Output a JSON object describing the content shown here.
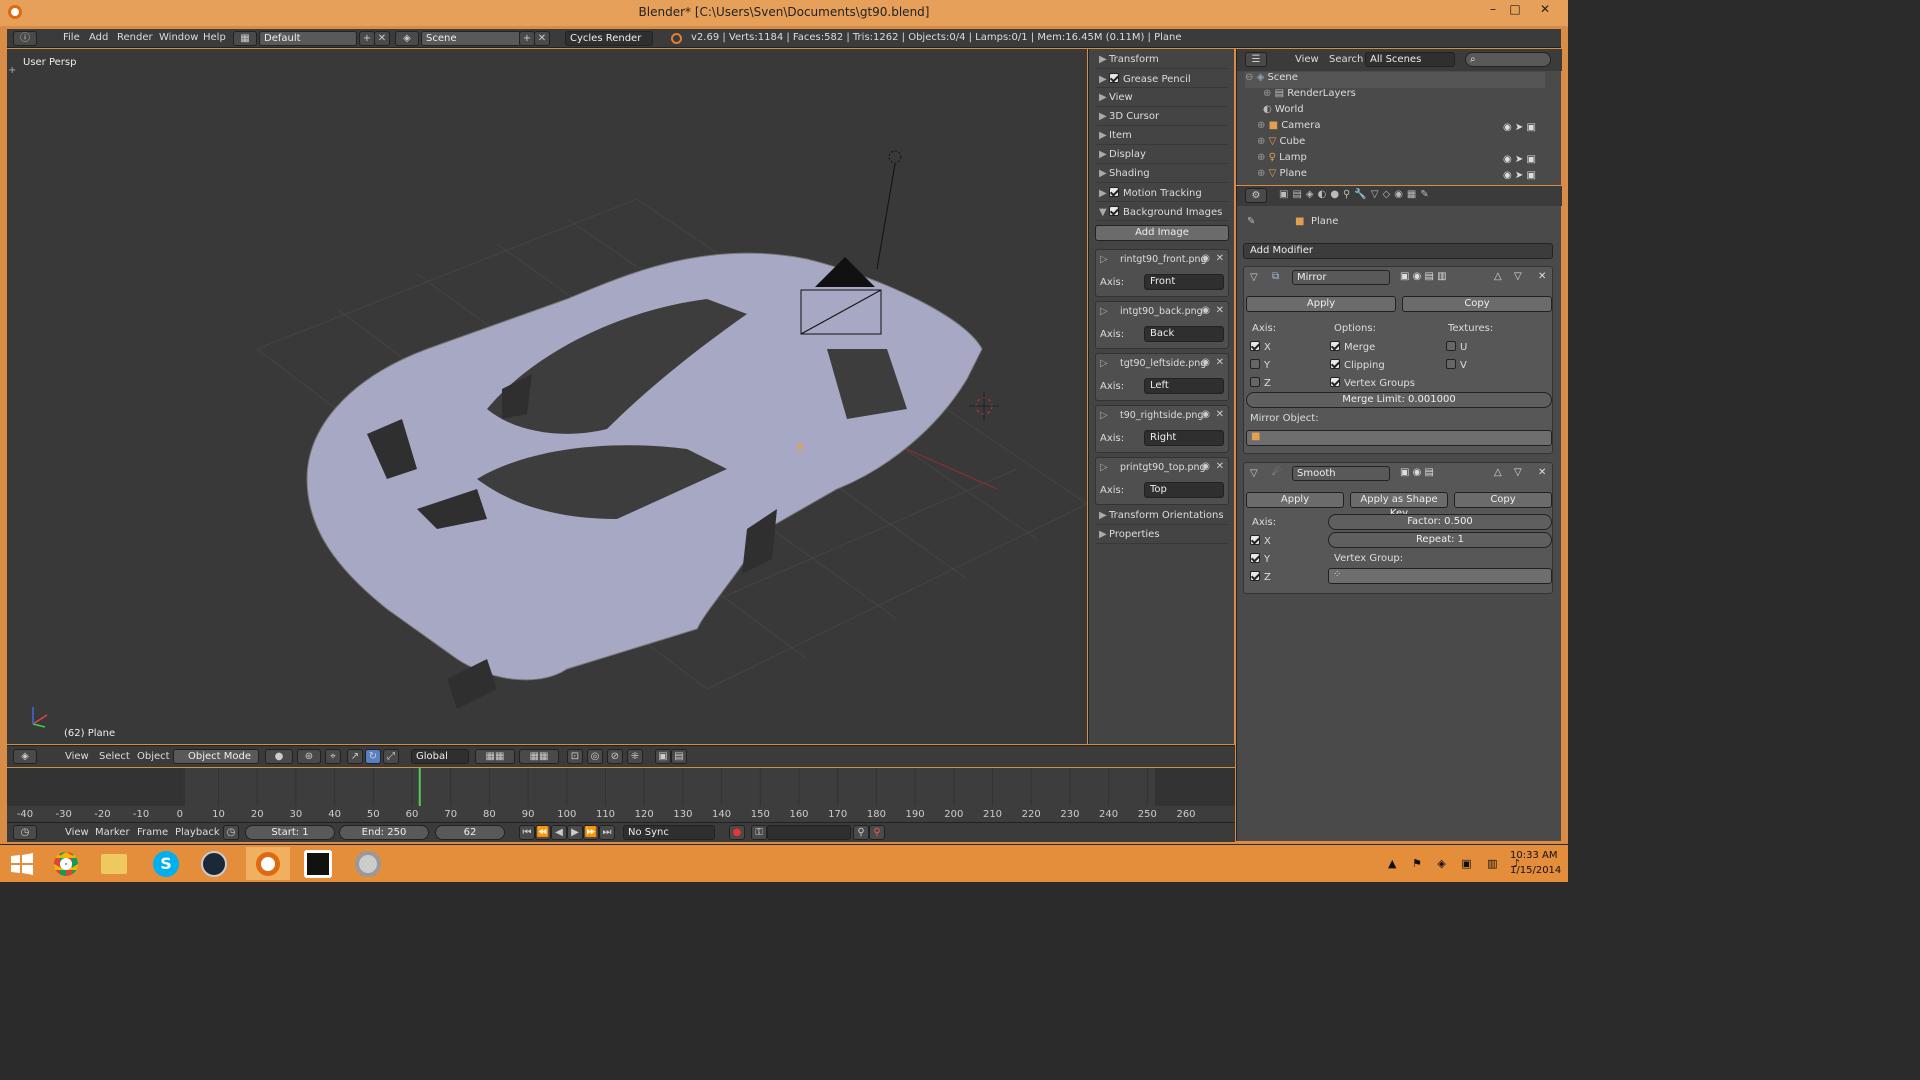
{
  "window": {
    "title": "Blender* [C:\\Users\\Sven\\Documents\\gt90.blend]",
    "minimize": "–",
    "maximize": "□",
    "close": "✕"
  },
  "infobar": {
    "menus": [
      "File",
      "Add",
      "Render",
      "Window",
      "Help"
    ],
    "layout": "Default",
    "scene": "Scene",
    "engine": "Cycles Render",
    "stats": "v2.69 | Verts:1184 | Faces:582 | Tris:1262 | Objects:0/4 | Lamps:0/1 | Mem:16.45M (0.11M) | Plane"
  },
  "viewport": {
    "view_label": "User Persp",
    "object_label": "(62) Plane"
  },
  "npanel": {
    "sections": [
      {
        "label": "Transform",
        "check": false
      },
      {
        "label": "Grease Pencil",
        "check": true
      },
      {
        "label": "View",
        "check": false
      },
      {
        "label": "3D Cursor",
        "check": false
      },
      {
        "label": "Item",
        "check": false
      },
      {
        "label": "Display",
        "check": false
      },
      {
        "label": "Shading",
        "check": false
      },
      {
        "label": "Motion Tracking",
        "check": true
      },
      {
        "label": "Background Images",
        "check": true,
        "open": true
      }
    ],
    "add_image": "Add Image",
    "axis_label": "Axis:",
    "bg_images": [
      {
        "name": "rintgt90_front.png",
        "axis": "Front"
      },
      {
        "name": "intgt90_back.png",
        "axis": "Back"
      },
      {
        "name": "tgt90_leftside.png",
        "axis": "Left"
      },
      {
        "name": "t90_rightside.png",
        "axis": "Right"
      },
      {
        "name": "printgt90_top.png",
        "axis": "Top"
      }
    ],
    "after_sections": [
      "Transform Orientations",
      "Properties"
    ]
  },
  "outliner": {
    "menus": [
      "View",
      "Search"
    ],
    "filter": "All Scenes",
    "rows": [
      "Scene",
      "RenderLayers",
      "World",
      "Camera",
      "Cube",
      "Lamp",
      "Plane"
    ]
  },
  "properties": {
    "context": "Plane",
    "add_modifier": "Add Modifier",
    "mirror": {
      "name": "Mirror",
      "apply": "Apply",
      "copy": "Copy",
      "axis_label": "Axis:",
      "options_label": "Options:",
      "textures_label": "Textures:",
      "axes": [
        {
          "label": "X",
          "on": true
        },
        {
          "label": "Y",
          "on": false
        },
        {
          "label": "Z",
          "on": false
        }
      ],
      "options": [
        {
          "label": "Merge",
          "on": true
        },
        {
          "label": "Clipping",
          "on": true
        },
        {
          "label": "Vertex Groups",
          "on": true
        }
      ],
      "textures": [
        {
          "label": "U",
          "on": false
        },
        {
          "label": "V",
          "on": false
        }
      ],
      "merge_limit": "Merge Limit: 0.001000",
      "mirror_object_label": "Mirror Object:"
    },
    "smooth": {
      "name": "Smooth",
      "apply": "Apply",
      "apply_shape": "Apply as Shape Key",
      "copy": "Copy",
      "axis_label": "Axis:",
      "axes": [
        {
          "label": "X",
          "on": true
        },
        {
          "label": "Y",
          "on": true
        },
        {
          "label": "Z",
          "on": true
        }
      ],
      "factor": "Factor: 0.500",
      "repeat": "Repeat: 1",
      "vertex_group_label": "Vertex Group:"
    }
  },
  "view3d_header": {
    "menus": [
      "View",
      "Select",
      "Object"
    ],
    "mode": "Object Mode",
    "orientation": "Global"
  },
  "timeline": {
    "ticks": [
      "-40",
      "-30",
      "-20",
      "-10",
      "0",
      "10",
      "20",
      "30",
      "40",
      "50",
      "60",
      "70",
      "80",
      "90",
      "100",
      "110",
      "120",
      "130",
      "140",
      "150",
      "160",
      "170",
      "180",
      "190",
      "200",
      "210",
      "220",
      "230",
      "240",
      "250",
      "260"
    ],
    "current_frame_value": 62
  },
  "timeline_header": {
    "menus": [
      "View",
      "Marker",
      "Frame",
      "Playback"
    ],
    "start": "Start: 1",
    "end": "End: 250",
    "frame": "62",
    "sync": "No Sync"
  },
  "taskbar": {
    "time": "10:33 AM",
    "date": "1/15/2014"
  }
}
